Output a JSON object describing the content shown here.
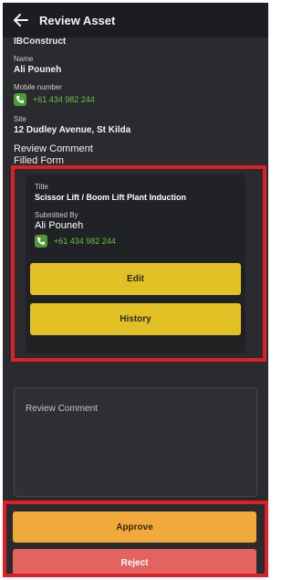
{
  "header": {
    "title": "Review Asset",
    "back_icon": "arrow-left-icon"
  },
  "asset": {
    "company": "IBConstruct",
    "name_label": "Name",
    "name": "Ali Pouneh",
    "mobile_label": "Mobile number",
    "mobile": "+61 434 982 244",
    "site_label": "Site",
    "site": "12 Dudley Avenue, St Kilda"
  },
  "review_comment_heading": "Review Comment",
  "filled_form_heading": "Filled Form",
  "form_card": {
    "title_label": "Title",
    "title": "Scissor Lift / Boom Lift Plant Induction",
    "submitted_by_label": "Submitted By",
    "submitted_by": "Ali Pouneh",
    "phone": "+61 434 982 244",
    "edit_label": "Edit",
    "history_label": "History"
  },
  "comment_input": {
    "placeholder": "Review Comment"
  },
  "actions": {
    "approve_label": "Approve",
    "reject_label": "Reject"
  },
  "colors": {
    "background": "#2a2b2f",
    "header": "#1c1d20",
    "phone_green": "#6cc04a",
    "button_yellow": "#e2c124",
    "approve_orange": "#f2a93b",
    "reject_red": "#e2635f",
    "highlight_red": "#dd1f26"
  }
}
